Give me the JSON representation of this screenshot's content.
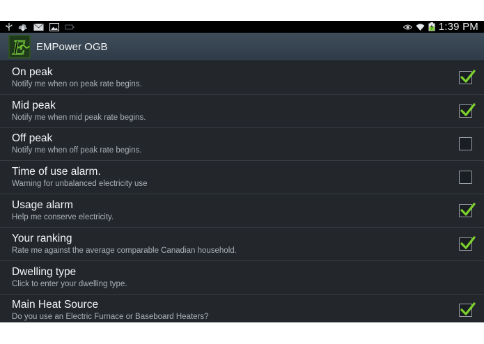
{
  "status_bar": {
    "time": "1:39 PM",
    "left_icons": [
      "usb-icon",
      "download-icon",
      "mail-icon",
      "image-icon",
      "battery-outline-icon"
    ],
    "right_icons": [
      "eye-icon",
      "wifi-icon",
      "battery-charging-icon"
    ]
  },
  "action_bar": {
    "title": "EMPower OGB",
    "logo_letter": "E"
  },
  "colors": {
    "background": "#23272c",
    "check": "#7cd22c",
    "divider": "#353b41"
  },
  "preferences": [
    {
      "title": "On peak",
      "summary": "Notify me when on peak rate begins.",
      "checkbox": true,
      "checked": true
    },
    {
      "title": "Mid peak",
      "summary": "Notify me when mid peak rate begins.",
      "checkbox": true,
      "checked": true
    },
    {
      "title": "Off peak",
      "summary": "Notify me when off peak rate begins.",
      "checkbox": true,
      "checked": false
    },
    {
      "title": "Time of use alarm.",
      "summary": "Warning for unbalanced electricity use",
      "checkbox": true,
      "checked": false
    },
    {
      "title": "Usage alarm",
      "summary": "Help me conserve electricity.",
      "checkbox": true,
      "checked": true
    },
    {
      "title": "Your ranking",
      "summary": "Rate me against the average comparable Canadian household.",
      "checkbox": true,
      "checked": true
    },
    {
      "title": "Dwelling type",
      "summary": "Click to enter your dwelling type.",
      "checkbox": false,
      "checked": false
    },
    {
      "title": "Main Heat Source",
      "summary": "Do you use an Electric Furnace or Baseboard Heaters?",
      "checkbox": true,
      "checked": true
    }
  ]
}
